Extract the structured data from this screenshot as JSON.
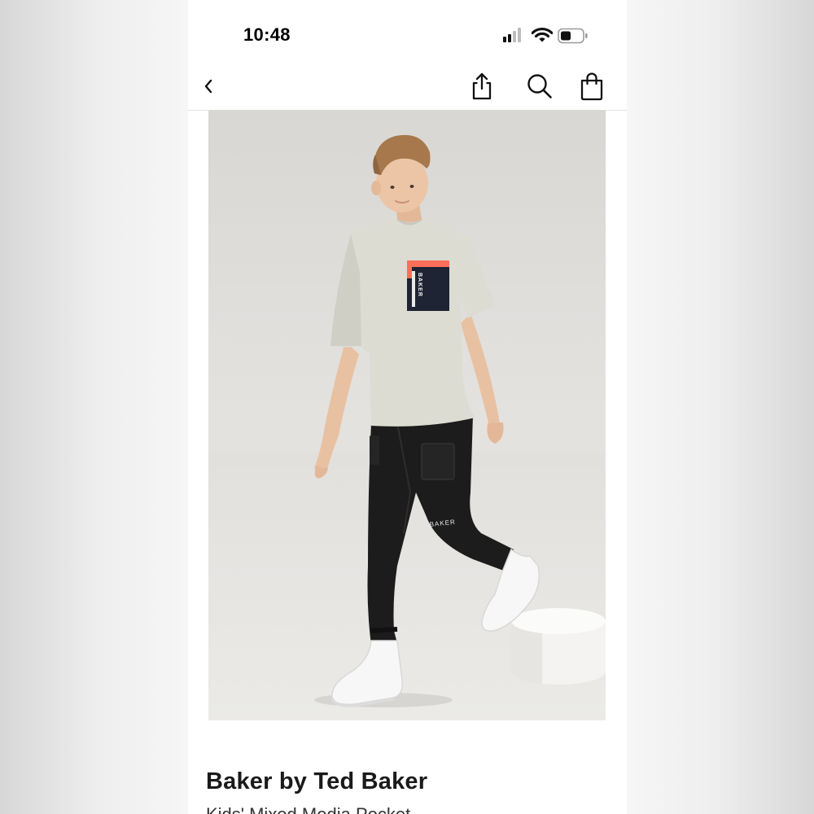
{
  "status_bar": {
    "time": "10:48",
    "icons": [
      "cellular-signal-icon",
      "wifi-icon",
      "battery-icon"
    ]
  },
  "nav_bar": {
    "icons": [
      "back-chevron-icon",
      "share-icon",
      "search-icon",
      "shopping-bag-icon"
    ]
  },
  "product": {
    "image_logo_text": "BAKER",
    "brand": "Baker by Ted Baker",
    "title": "Kids' Mixed Media Pocket"
  },
  "colors": {
    "text_primary": "#1a1a1a",
    "pocket_accent": "#ff6e5a",
    "pocket_navy": "#1e2433",
    "divider": "#e4e4e4"
  }
}
